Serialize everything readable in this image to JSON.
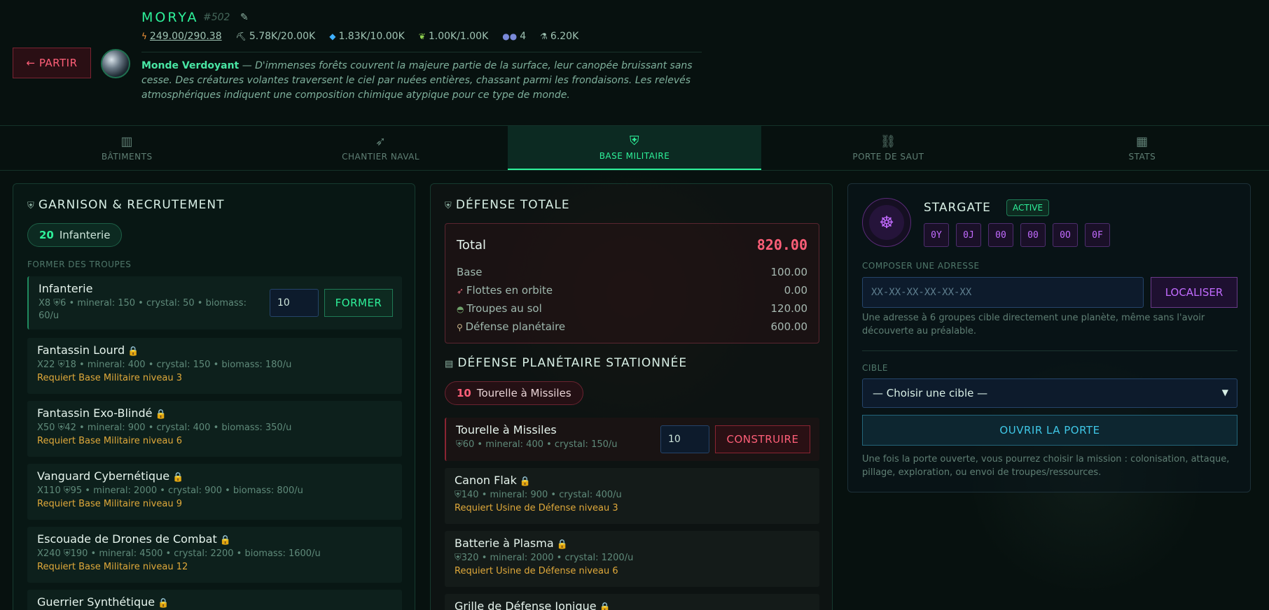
{
  "header": {
    "back_label": "← PARTIR",
    "planet_name": "MORYA",
    "planet_id": "#502",
    "resources": {
      "energy": "249.00/290.38",
      "mineral": "5.78K/20.00K",
      "crystal": "1.83K/10.00K",
      "biomass": "1.00K/1.00K",
      "population": "4",
      "research": "6.20K"
    },
    "description_title": "Monde Verdoyant",
    "description_text": " — D'immenses forêts couvrent la majeure partie de la surface, leur canopée bruissant sans cesse. Des créatures volantes traversent le ciel par nuées entières, chassant parmi les frondaisons. Les relevés atmosphériques indiquent une composition chimique atypique pour ce type de monde."
  },
  "tabs": [
    {
      "label": "BÂTIMENTS",
      "icon": "buildings-icon"
    },
    {
      "label": "CHANTIER NAVAL",
      "icon": "rocket-icon"
    },
    {
      "label": "BASE MILITAIRE",
      "icon": "shield-icon",
      "active": true
    },
    {
      "label": "PORTE DE SAUT",
      "icon": "network-icon"
    },
    {
      "label": "STATS",
      "icon": "bar-chart-icon"
    }
  ],
  "garrison": {
    "title": "GARNISON & RECRUTEMENT",
    "pill_count": "20",
    "pill_label": "Infanterie",
    "subhead": "FORMER DES TROUPES",
    "qty_value": "10",
    "train_label": "FORMER",
    "units": [
      {
        "name": "Infanterie",
        "stats": "X8 ⛨6 • mineral: 150 • crystal: 50 • biomass: 60/u",
        "req": ""
      },
      {
        "name": "Fantassin Lourd",
        "stats": "X22 ⛨18 • mineral: 400 • crystal: 150 • biomass: 180/u",
        "req": "Requiert Base Militaire niveau 3"
      },
      {
        "name": "Fantassin Exo-Blindé",
        "stats": "X50 ⛨42 • mineral: 900 • crystal: 400 • biomass: 350/u",
        "req": "Requiert Base Militaire niveau 6"
      },
      {
        "name": "Vanguard Cybernétique",
        "stats": "X110 ⛨95 • mineral: 2000 • crystal: 900 • biomass: 800/u",
        "req": "Requiert Base Militaire niveau 9"
      },
      {
        "name": "Escouade de Drones de Combat",
        "stats": "X240 ⛨190 • mineral: 4500 • crystal: 2200 • biomass: 1600/u",
        "req": "Requiert Base Militaire niveau 12"
      },
      {
        "name": "Guerrier Synthétique",
        "stats": "",
        "req": ""
      }
    ]
  },
  "defense": {
    "title": "DÉFENSE TOTALE",
    "total_label": "Total",
    "total_value": "820.00",
    "rows": [
      {
        "label": "Base",
        "value": "100.00",
        "icon": ""
      },
      {
        "label": "Flottes en orbite",
        "value": "0.00",
        "icon": "🚀"
      },
      {
        "label": "Troupes au sol",
        "value": "120.00",
        "icon": "🪖"
      },
      {
        "label": "Défense planétaire",
        "value": "600.00",
        "icon": "📡"
      }
    ],
    "stationed_title": "DÉFENSE PLANÉTAIRE STATIONNÉE",
    "pill_count": "10",
    "pill_label": "Tourelle à Missiles",
    "qty_value": "10",
    "build_label": "CONSTRUIRE",
    "items": [
      {
        "name": "Tourelle à Missiles",
        "stats": "⛨60 • mineral: 400 • crystal: 150/u",
        "req": ""
      },
      {
        "name": "Canon Flak",
        "stats": "⛨140 • mineral: 900 • crystal: 400/u",
        "req": "Requiert Usine de Défense niveau 3"
      },
      {
        "name": "Batterie à Plasma",
        "stats": "⛨320 • mineral: 2000 • crystal: 1200/u",
        "req": "Requiert Usine de Défense niveau 6"
      },
      {
        "name": "Grille de Défense Ionique",
        "stats": "",
        "req": ""
      }
    ]
  },
  "stargate": {
    "title": "STARGATE",
    "badge": "ACTIVE",
    "glyphs": [
      "0Y",
      "0J",
      "00",
      "00",
      "0O",
      "0F"
    ],
    "compose_label": "COMPOSER UNE ADRESSE",
    "address_placeholder": "XX-XX-XX-XX-XX-XX",
    "locate_label": "LOCALISER",
    "address_hint": "Une adresse à 6 groupes cible directement une planète, même sans l'avoir découverte au préalable.",
    "target_label": "CIBLE",
    "target_value": "— Choisir une cible —",
    "open_label": "OUVRIR LA PORTE",
    "open_hint": "Une fois la porte ouverte, vous pourrez choisir la mission : colonisation, attaque, pillage, exploration, ou envoi de troupes/ressources."
  },
  "colors": {
    "accent": "#2ef19a",
    "danger": "#ff5f78",
    "warning": "#e0a93a",
    "purple": "#c26bff",
    "cyan": "#3fc7e6"
  }
}
